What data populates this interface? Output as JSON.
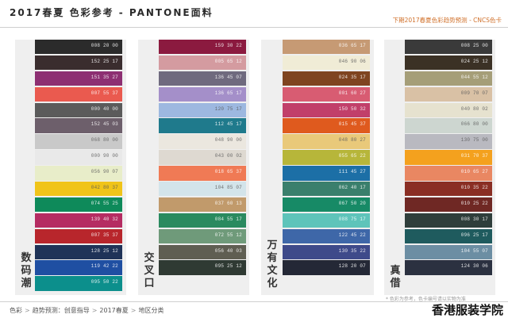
{
  "header": {
    "title": "2017春夏 色彩参考 - PANTONE面料",
    "right_text": "下期2017春夏色彩趋势预测 - CNCS色卡"
  },
  "groups": [
    {
      "label": "数码潮",
      "swatches": [
        {
          "code": "008 20 00",
          "color": "#2b2b2b"
        },
        {
          "code": "152 25 17",
          "color": "#3a2d2e"
        },
        {
          "code": "151 35 27",
          "color": "#8d2f72"
        },
        {
          "code": "007 55 37",
          "color": "#ea5a4f"
        },
        {
          "code": "000 40 00",
          "color": "#5b5b5b"
        },
        {
          "code": "152 45 03",
          "color": "#6d5f6b"
        },
        {
          "code": "068 80 00",
          "color": "#c9c9c9",
          "light": true
        },
        {
          "code": "000 90 00",
          "color": "#e9e9e9",
          "light": true
        },
        {
          "code": "056 90 07",
          "color": "#e8edc9",
          "light": true
        },
        {
          "code": "042 80 37",
          "color": "#f0c419",
          "light": true
        },
        {
          "code": "074 55 25",
          "color": "#0e8a5a"
        },
        {
          "code": "139 40 32",
          "color": "#b52c62"
        },
        {
          "code": "007 35 37",
          "color": "#b8262c"
        },
        {
          "code": "128 25 12",
          "color": "#1f3358"
        },
        {
          "code": "119 42 22",
          "color": "#1f4fa2"
        },
        {
          "code": "095 50 22",
          "color": "#0c8f8c"
        }
      ]
    },
    {
      "label": "交叉口",
      "swatches": [
        {
          "code": "159 30 22",
          "color": "#8b1a3f"
        },
        {
          "code": "005 65 12",
          "color": "#d49ba0"
        },
        {
          "code": "136 45 07",
          "color": "#6f6a7e"
        },
        {
          "code": "136 65 17",
          "color": "#a48fc9"
        },
        {
          "code": "120 75 17",
          "color": "#9db8e0",
          "light": true
        },
        {
          "code": "112 45 17",
          "color": "#1f7a8c"
        },
        {
          "code": "048 90 00",
          "color": "#ebe7df",
          "light": true
        },
        {
          "code": "043 00 02",
          "color": "#ded9d1",
          "light": true
        },
        {
          "code": "018 65 37",
          "color": "#f07a55"
        },
        {
          "code": "104 85 07",
          "color": "#d3e4ea",
          "light": true
        },
        {
          "code": "037 60 13",
          "color": "#c19a6b"
        },
        {
          "code": "084 55 17",
          "color": "#2a8a5f"
        },
        {
          "code": "072 55 12",
          "color": "#6f9a7a"
        },
        {
          "code": "056 40 03",
          "color": "#5f5e52"
        },
        {
          "code": "095 25 12",
          "color": "#2f3a33"
        }
      ]
    },
    {
      "label": "万有文化",
      "swatches": [
        {
          "code": "036 65 17",
          "color": "#c69a74"
        },
        {
          "code": "046 90 06",
          "color": "#f0ecd6",
          "light": true
        },
        {
          "code": "024 35 17",
          "color": "#7f4420"
        },
        {
          "code": "001 60 27",
          "color": "#d85c72"
        },
        {
          "code": "150 50 32",
          "color": "#c13f6a"
        },
        {
          "code": "015 45 37",
          "color": "#df5a1e"
        },
        {
          "code": "048 80 27",
          "color": "#e9c97a",
          "light": true
        },
        {
          "code": "055 65 22",
          "color": "#b7b63a"
        },
        {
          "code": "111 45 27",
          "color": "#1c6fa6"
        },
        {
          "code": "062 40 17",
          "color": "#3a7f6c"
        },
        {
          "code": "067 50 20",
          "color": "#178a66"
        },
        {
          "code": "088 75 17",
          "color": "#5ec4ba"
        },
        {
          "code": "122 45 22",
          "color": "#3e67a8"
        },
        {
          "code": "130 35 22",
          "color": "#3e4a8a"
        },
        {
          "code": "128 20 07",
          "color": "#242836"
        }
      ]
    },
    {
      "label": "真借",
      "swatches": [
        {
          "code": "008 25 00",
          "color": "#3a3a3a"
        },
        {
          "code": "024 25 12",
          "color": "#3b3125"
        },
        {
          "code": "044 55 12",
          "color": "#a59e78"
        },
        {
          "code": "009 70 07",
          "color": "#d9c1a5",
          "light": true
        },
        {
          "code": "040 80 02",
          "color": "#e6e2cf",
          "light": true
        },
        {
          "code": "066 80 00",
          "color": "#cdd6d0",
          "light": true
        },
        {
          "code": "130 75 00",
          "color": "#b9b9c0",
          "light": true
        },
        {
          "code": "031 70 37",
          "color": "#f4a11e"
        },
        {
          "code": "010 65 27",
          "color": "#e98762"
        },
        {
          "code": "010 35 22",
          "color": "#8a2e24"
        },
        {
          "code": "010 25 22",
          "color": "#6f2824"
        },
        {
          "code": "008 30 17",
          "color": "#2f3e3b"
        },
        {
          "code": "096 25 17",
          "color": "#1f5b5e"
        },
        {
          "code": "104 55 07",
          "color": "#6c8ea3"
        },
        {
          "code": "124 30 06",
          "color": "#2b3140"
        }
      ]
    }
  ],
  "note": "* 色彩为参考，色卡编号请以实物为准",
  "breadcrumb": [
    "色彩",
    "趋势预测：创意指导",
    "2017春夏",
    "地区分类"
  ],
  "breadcrumb_separator": ">",
  "watermark": "香港服装学院"
}
